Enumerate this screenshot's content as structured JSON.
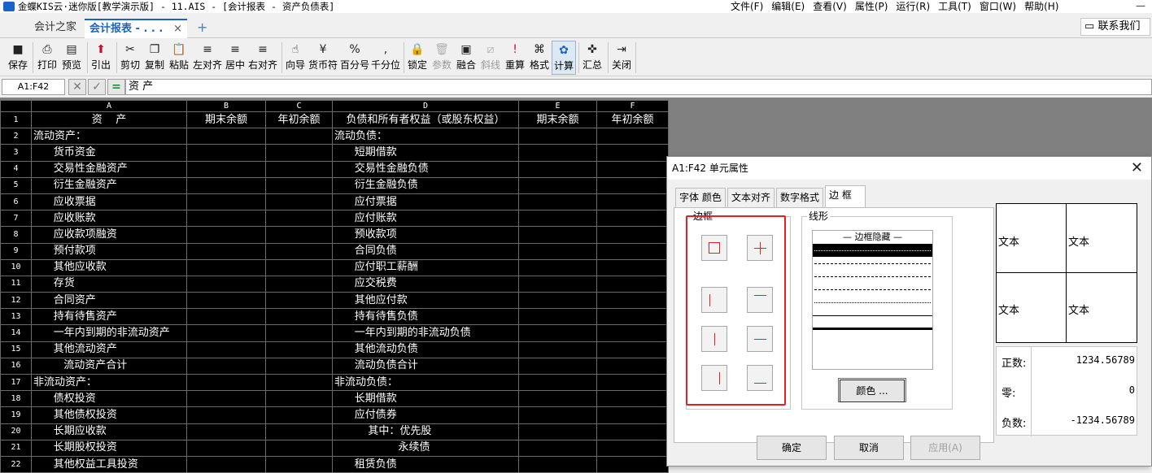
{
  "titlebar": {
    "title": "金蝶KIS云·迷你版[教学演示版] - 11.AIS - [会计报表 - 资产负债表]",
    "menu": [
      "文件(F)",
      "编辑(E)",
      "查看(V)",
      "属性(P)",
      "运行(R)",
      "工具(T)",
      "窗口(W)",
      "帮助(H)"
    ]
  },
  "tabs": {
    "home": "会计之家",
    "active": "会计报表 - . . .",
    "close": "×",
    "add": "+"
  },
  "contact": "联系我们",
  "toolbar": [
    {
      "label": "保存",
      "icon": "save-icon"
    },
    {
      "label": "打印",
      "icon": "print-icon"
    },
    {
      "label": "预览",
      "icon": "preview-icon"
    },
    {
      "label": "引出",
      "icon": "export-icon"
    },
    {
      "label": "剪切",
      "icon": "cut-icon"
    },
    {
      "label": "复制",
      "icon": "copy-icon"
    },
    {
      "label": "粘贴",
      "icon": "paste-icon"
    },
    {
      "label": "左对齐",
      "icon": "align-left-icon"
    },
    {
      "label": "居中",
      "icon": "align-center-icon"
    },
    {
      "label": "右对齐",
      "icon": "align-right-icon"
    },
    {
      "label": "向导",
      "icon": "wizard-icon"
    },
    {
      "label": "货币符",
      "icon": "currency-icon"
    },
    {
      "label": "百分号",
      "icon": "percent-icon"
    },
    {
      "label": "千分位",
      "icon": "thousands-icon"
    },
    {
      "label": "锁定",
      "icon": "lock-icon"
    },
    {
      "label": "参数",
      "icon": "params-icon"
    },
    {
      "label": "融合",
      "icon": "merge-icon"
    },
    {
      "label": "斜线",
      "icon": "diagonal-icon"
    },
    {
      "label": "重算",
      "icon": "recalc-icon"
    },
    {
      "label": "格式",
      "icon": "format-icon"
    },
    {
      "label": "计算",
      "icon": "calculate-icon"
    },
    {
      "label": "汇总",
      "icon": "summary-icon"
    },
    {
      "label": "关闭",
      "icon": "close-icon"
    }
  ],
  "formula": {
    "cellref": "A1:F42",
    "content": "资    产"
  },
  "sheet": {
    "columns": [
      "A",
      "B",
      "C",
      "D",
      "E",
      "F"
    ],
    "rows": [
      [
        "资    产",
        "期末余额",
        "年初余额",
        "负债和所有者权益（或股东权益）",
        "期末余额",
        "年初余额"
      ],
      [
        "流动资产：",
        "",
        "",
        "流动负债：",
        "",
        ""
      ],
      [
        "      货币资金",
        "",
        "",
        "      短期借款",
        "",
        ""
      ],
      [
        "      交易性金融资产",
        "",
        "",
        "      交易性金融负债",
        "",
        ""
      ],
      [
        "      衍生金融资产",
        "",
        "",
        "      衍生金融负债",
        "",
        ""
      ],
      [
        "      应收票据",
        "",
        "",
        "      应付票据",
        "",
        ""
      ],
      [
        "      应收账款",
        "",
        "",
        "      应付账款",
        "",
        ""
      ],
      [
        "      应收款项融资",
        "",
        "",
        "      预收款项",
        "",
        ""
      ],
      [
        "      预付款项",
        "",
        "",
        "      合同负债",
        "",
        ""
      ],
      [
        "      其他应收款",
        "",
        "",
        "      应付职工薪酬",
        "",
        ""
      ],
      [
        "      存货",
        "",
        "",
        "      应交税费",
        "",
        ""
      ],
      [
        "      合同资产",
        "",
        "",
        "      其他应付款",
        "",
        ""
      ],
      [
        "      持有待售资产",
        "",
        "",
        "      持有待售负债",
        "",
        ""
      ],
      [
        "      一年内到期的非流动资产",
        "",
        "",
        "      一年内到期的非流动负债",
        "",
        ""
      ],
      [
        "      其他流动资产",
        "",
        "",
        "      其他流动负债",
        "",
        ""
      ],
      [
        "         流动资产合计",
        "",
        "",
        "      流动负债合计",
        "",
        ""
      ],
      [
        "非流动资产：",
        "",
        "",
        "非流动负债：",
        "",
        ""
      ],
      [
        "      债权投资",
        "",
        "",
        "      长期借款",
        "",
        ""
      ],
      [
        "      其他债权投资",
        "",
        "",
        "      应付债券",
        "",
        ""
      ],
      [
        "      长期应收款",
        "",
        "",
        "          其中：优先股",
        "",
        ""
      ],
      [
        "      长期股权投资",
        "",
        "",
        "                   永续债",
        "",
        ""
      ],
      [
        "      其他权益工具投资",
        "",
        "",
        "      租赁负债",
        "",
        ""
      ]
    ]
  },
  "dialog": {
    "title": "A1:F42 单元属性",
    "close": "✕",
    "tabs": [
      "字体 颜色",
      "文本对齐",
      "数字格式",
      "边  框"
    ],
    "border_group": "边框",
    "line_group": "线形",
    "line_hidden": "— 边框隐藏 —",
    "color_button": "颜色 ...",
    "ok": "确定",
    "cancel": "取消",
    "apply": "应用(A)",
    "preview_text": [
      "文本",
      "文本",
      "文本",
      "文本"
    ],
    "numbers": [
      {
        "label": "正数:",
        "value": "1234.56789"
      },
      {
        "label": "零:",
        "value": "0"
      },
      {
        "label": "负数:",
        "value": "-1234.56789"
      }
    ],
    "highlight_color": "#e62020"
  }
}
